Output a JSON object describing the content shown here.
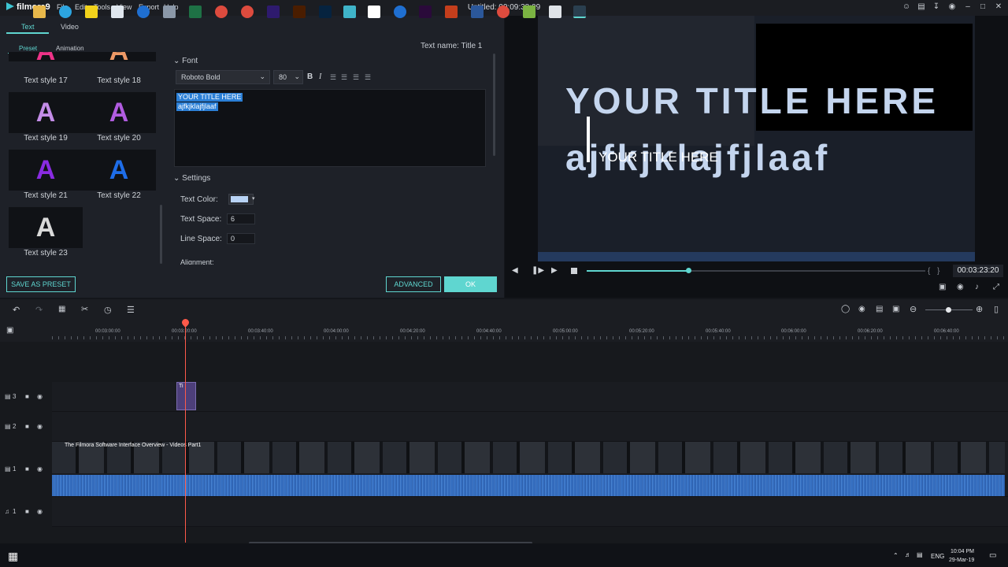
{
  "app": {
    "logo": "filmora9",
    "title": "Untitled:  00:09:38:09",
    "menu": [
      "File",
      "Edit",
      "Tools",
      "View",
      "Export",
      "Help"
    ]
  },
  "editor": {
    "tabs": [
      "Text",
      "Video"
    ],
    "subtabs": [
      "Preset",
      "Animation"
    ],
    "text_name": "Text name: Title 1",
    "styles": [
      {
        "label": "Text style 17",
        "color": "#e88"
      },
      {
        "label": "Text style 18",
        "color": "#e88"
      },
      {
        "label": "Text style 19",
        "color": "#c48de8"
      },
      {
        "label": "Text style 20",
        "color": "#b15ce0"
      },
      {
        "label": "Text style 21",
        "color": "#8a2be2"
      },
      {
        "label": "Text style 22",
        "color": "#1e6de8"
      },
      {
        "label": "Text style 23",
        "color": "#d9d9d9"
      }
    ],
    "font_section": "Font",
    "font_name": "Roboto Bold",
    "font_size": "80",
    "text_lines": [
      "YOUR TITLE HERE",
      "ajfkjklajfjlaaf"
    ],
    "settings_section": "Settings",
    "text_color_label": "Text Color:",
    "text_color": "#b8d3f5",
    "text_space_label": "Text Space:",
    "text_space": "6",
    "line_space_label": "Line Space:",
    "line_space": "0",
    "alignment_label": "Alignment:",
    "save_preset": "SAVE AS PRESET",
    "advanced": "ADVANCED",
    "ok": "OK"
  },
  "preview": {
    "title_line1": "YOUR TITLE HERE",
    "title_line2": "ajfkjklajfjlaaf",
    "ghost_text": "YOUR TITLE HERE",
    "timecode": "00:03:23:20",
    "progress": 0.3
  },
  "timeline": {
    "ruler": [
      "00:03:00:00",
      "00:03:20:00",
      "00:03:40:00",
      "00:04:00:00",
      "00:04:20:00",
      "00:04:40:00",
      "00:05:00:00",
      "00:05:20:00",
      "00:05:40:00",
      "00:06:00:00",
      "00:06:20:00",
      "00:06:40:00"
    ],
    "tracks": [
      "3",
      "2",
      "1",
      "1"
    ],
    "clip_title": "Ti",
    "video_clip_label": "The Filmora Software Interface Overview - Videos Part1"
  },
  "taskbar": {
    "lang": "ENG",
    "time": "10:04 PM",
    "date": "29-Mar-19"
  }
}
